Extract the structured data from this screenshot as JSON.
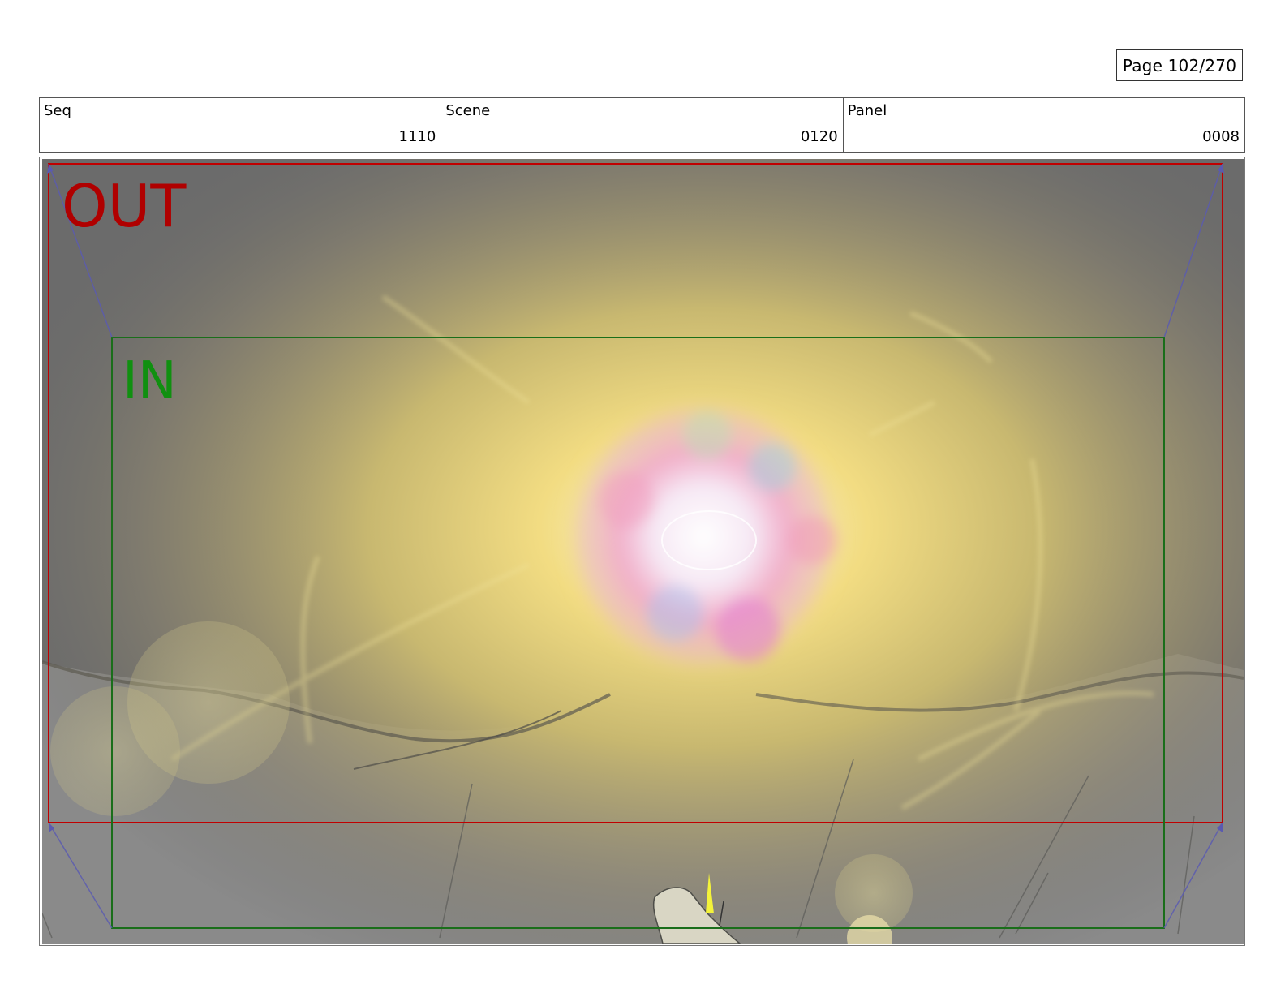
{
  "header": {
    "page_label": "Page 102/270"
  },
  "info": {
    "seq_label": "Seq",
    "seq_value": "1110",
    "scene_label": "Scene",
    "scene_value": "0120",
    "panel_label": "Panel",
    "panel_value": "0008"
  },
  "panel": {
    "out_label": "OUT",
    "in_label": "IN",
    "colors": {
      "out_frame": "#c00000",
      "in_frame": "#1a6e1a",
      "guide_lines": "#5a5ab0",
      "glow": "#f2dc82"
    }
  }
}
